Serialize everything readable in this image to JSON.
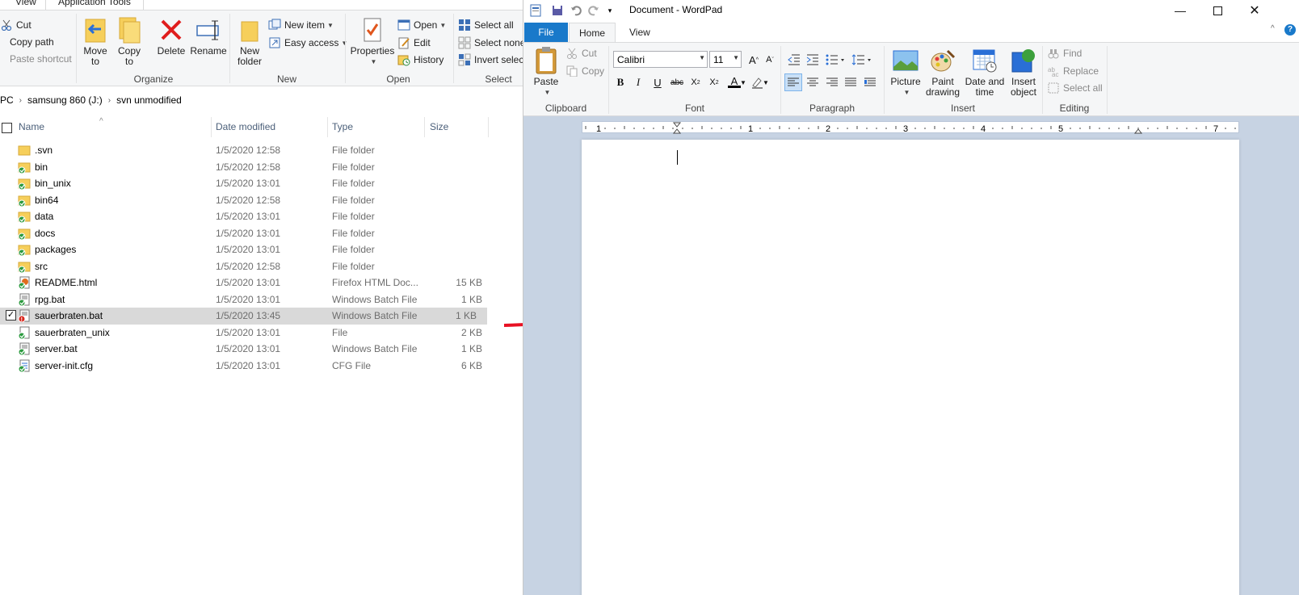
{
  "explorer": {
    "tabs": [
      "View",
      "Application Tools"
    ],
    "ribbon": {
      "clipboard_items": [
        "Cut",
        "Copy path",
        "Paste shortcut"
      ],
      "organize": {
        "label": "Organize",
        "move_to": "Move to",
        "copy_to": "Copy to",
        "delete": "Delete",
        "rename": "Rename"
      },
      "new": {
        "label": "New",
        "new_folder": "New folder",
        "new_item": "New item",
        "easy_access": "Easy access"
      },
      "open": {
        "label": "Open",
        "properties": "Properties",
        "open": "Open",
        "edit": "Edit",
        "history": "History"
      },
      "select": {
        "label": "Select",
        "select_all": "Select all",
        "select_none": "Select none",
        "invert_selection": "Invert select"
      }
    },
    "address": [
      "PC",
      "samsung 860 (J:)",
      "svn unmodified"
    ],
    "columns": {
      "name": "Name",
      "date": "Date modified",
      "type": "Type",
      "size": "Size"
    },
    "files": [
      {
        "name": ".svn",
        "date": "1/5/2020 12:58",
        "type": "File folder",
        "size": "",
        "icon": "folder-icon"
      },
      {
        "name": "bin",
        "date": "1/5/2020 12:58",
        "type": "File folder",
        "size": "",
        "icon": "folder-svn-ok-icon"
      },
      {
        "name": "bin_unix",
        "date": "1/5/2020 13:01",
        "type": "File folder",
        "size": "",
        "icon": "folder-svn-ok-icon"
      },
      {
        "name": "bin64",
        "date": "1/5/2020 12:58",
        "type": "File folder",
        "size": "",
        "icon": "folder-svn-ok-icon"
      },
      {
        "name": "data",
        "date": "1/5/2020 13:01",
        "type": "File folder",
        "size": "",
        "icon": "folder-svn-ok-icon"
      },
      {
        "name": "docs",
        "date": "1/5/2020 13:01",
        "type": "File folder",
        "size": "",
        "icon": "folder-svn-ok-icon"
      },
      {
        "name": "packages",
        "date": "1/5/2020 13:01",
        "type": "File folder",
        "size": "",
        "icon": "folder-svn-ok-icon"
      },
      {
        "name": "src",
        "date": "1/5/2020 12:58",
        "type": "File folder",
        "size": "",
        "icon": "folder-svn-ok-icon"
      },
      {
        "name": "README.html",
        "date": "1/5/2020 13:01",
        "type": "Firefox HTML Doc...",
        "size": "15 KB",
        "icon": "html-svn-ok-icon"
      },
      {
        "name": "rpg.bat",
        "date": "1/5/2020 13:01",
        "type": "Windows Batch File",
        "size": "1 KB",
        "icon": "bat-svn-ok-icon"
      },
      {
        "name": "sauerbraten.bat",
        "date": "1/5/2020 13:45",
        "type": "Windows Batch File",
        "size": "1 KB",
        "icon": "bat-svn-modified-icon",
        "selected": true
      },
      {
        "name": "sauerbraten_unix",
        "date": "1/5/2020 13:01",
        "type": "File",
        "size": "2 KB",
        "icon": "file-svn-ok-icon"
      },
      {
        "name": "server.bat",
        "date": "1/5/2020 13:01",
        "type": "Windows Batch File",
        "size": "1 KB",
        "icon": "bat-svn-ok-icon"
      },
      {
        "name": "server-init.cfg",
        "date": "1/5/2020 13:01",
        "type": "CFG File",
        "size": "6 KB",
        "icon": "cfg-svn-ok-icon"
      }
    ]
  },
  "wordpad": {
    "title": "Document - WordPad",
    "tabs": {
      "file": "File",
      "home": "Home",
      "view": "View"
    },
    "clipboard": {
      "label": "Clipboard",
      "paste": "Paste",
      "cut": "Cut",
      "copy": "Copy"
    },
    "font": {
      "label": "Font",
      "family": "Calibri",
      "size": "11"
    },
    "paragraph": {
      "label": "Paragraph"
    },
    "insert": {
      "label": "Insert",
      "picture": "Picture",
      "paint_drawing": "Paint drawing",
      "date_time": "Date and time",
      "insert_object": "Insert object"
    },
    "editing": {
      "label": "Editing",
      "find": "Find",
      "replace": "Replace",
      "select_all": "Select all"
    },
    "ruler_numbers": [
      "1",
      "1",
      "2",
      "3",
      "4",
      "5",
      "7"
    ],
    "colors": {
      "file_tab": "#1979ca",
      "canvas": "#c7d3e3",
      "accent_red": "#e81123"
    }
  }
}
